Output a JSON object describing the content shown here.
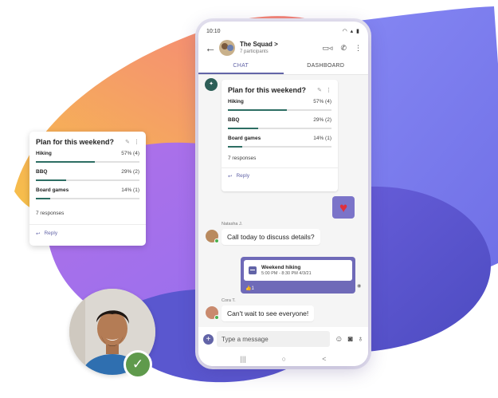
{
  "colors": {
    "accent": "#6264a7",
    "poll_bar": "#2d6e63",
    "heart": "#e0303c",
    "presence": "#4caf50"
  },
  "status_bar": {
    "time": "10:10",
    "icons": "wifi-signal-battery-icons"
  },
  "chat_header": {
    "back_icon": "back-arrow-icon",
    "title": "The Squad >",
    "subtitle": "7 participants",
    "icons": [
      "video-call-icon",
      "phone-call-icon",
      "more-options-icon"
    ]
  },
  "tabs": [
    {
      "label": "CHAT",
      "active": true
    },
    {
      "label": "DASHBOARD",
      "active": false
    }
  ],
  "poll": {
    "title": "Plan for this weekend?",
    "options": [
      {
        "label": "Hiking",
        "value": "57% (4)",
        "percent": 57
      },
      {
        "label": "BBQ",
        "value": "29% (2)",
        "percent": 29
      },
      {
        "label": "Board games",
        "value": "14% (1)",
        "percent": 14
      }
    ],
    "responses": "7 responses",
    "reply_label": "Reply"
  },
  "messages": {
    "natasha": {
      "sender": "Natasha J.",
      "text": "Call today to discuss details?"
    },
    "event": {
      "title": "Weekend hiking",
      "time": "5:00 PM - 8:30 PM 4/3/21",
      "reaction": "👍1"
    },
    "cora": {
      "sender": "Cora T.",
      "text": "Can't wait to see everyone!"
    }
  },
  "composer": {
    "placeholder": "Type a message"
  },
  "navbar": {
    "recent": "|||",
    "home": "○",
    "back": "<"
  }
}
